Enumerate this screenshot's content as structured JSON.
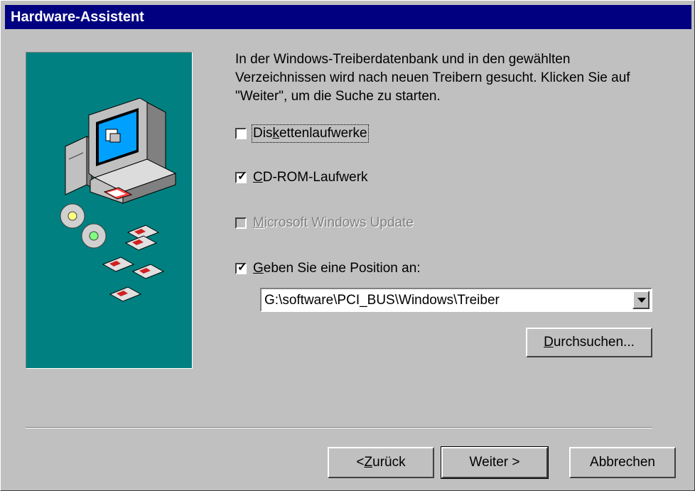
{
  "window": {
    "title": "Hardware-Assistent"
  },
  "description": "In der Windows-Treiberdatenbank und in den gewählten Verzeichnissen wird nach neuen Treibern gesucht. Klicken Sie auf \"Weiter\", um die Suche zu starten.",
  "options": [
    {
      "pre": "Dis",
      "key": "k",
      "post": "ettenlaufwerke",
      "checked": false,
      "enabled": true,
      "focused": true
    },
    {
      "pre": "",
      "key": "C",
      "post": "D-ROM-Laufwerk",
      "checked": true,
      "enabled": true
    },
    {
      "pre": "",
      "key": "M",
      "post": "icrosoft Windows Update",
      "checked": false,
      "enabled": false
    },
    {
      "pre": "",
      "key": "G",
      "post": "eben Sie eine Position an:",
      "checked": true,
      "enabled": true
    }
  ],
  "location": {
    "value": "G:\\software\\PCI_BUS\\Windows\\Treiber"
  },
  "browse": {
    "pre": "",
    "key": "D",
    "post": "urchsuchen..."
  },
  "nav": {
    "back": {
      "pre": "< ",
      "key": "Z",
      "post": "urück"
    },
    "next": "Weiter >",
    "cancel": "Abbrechen"
  }
}
